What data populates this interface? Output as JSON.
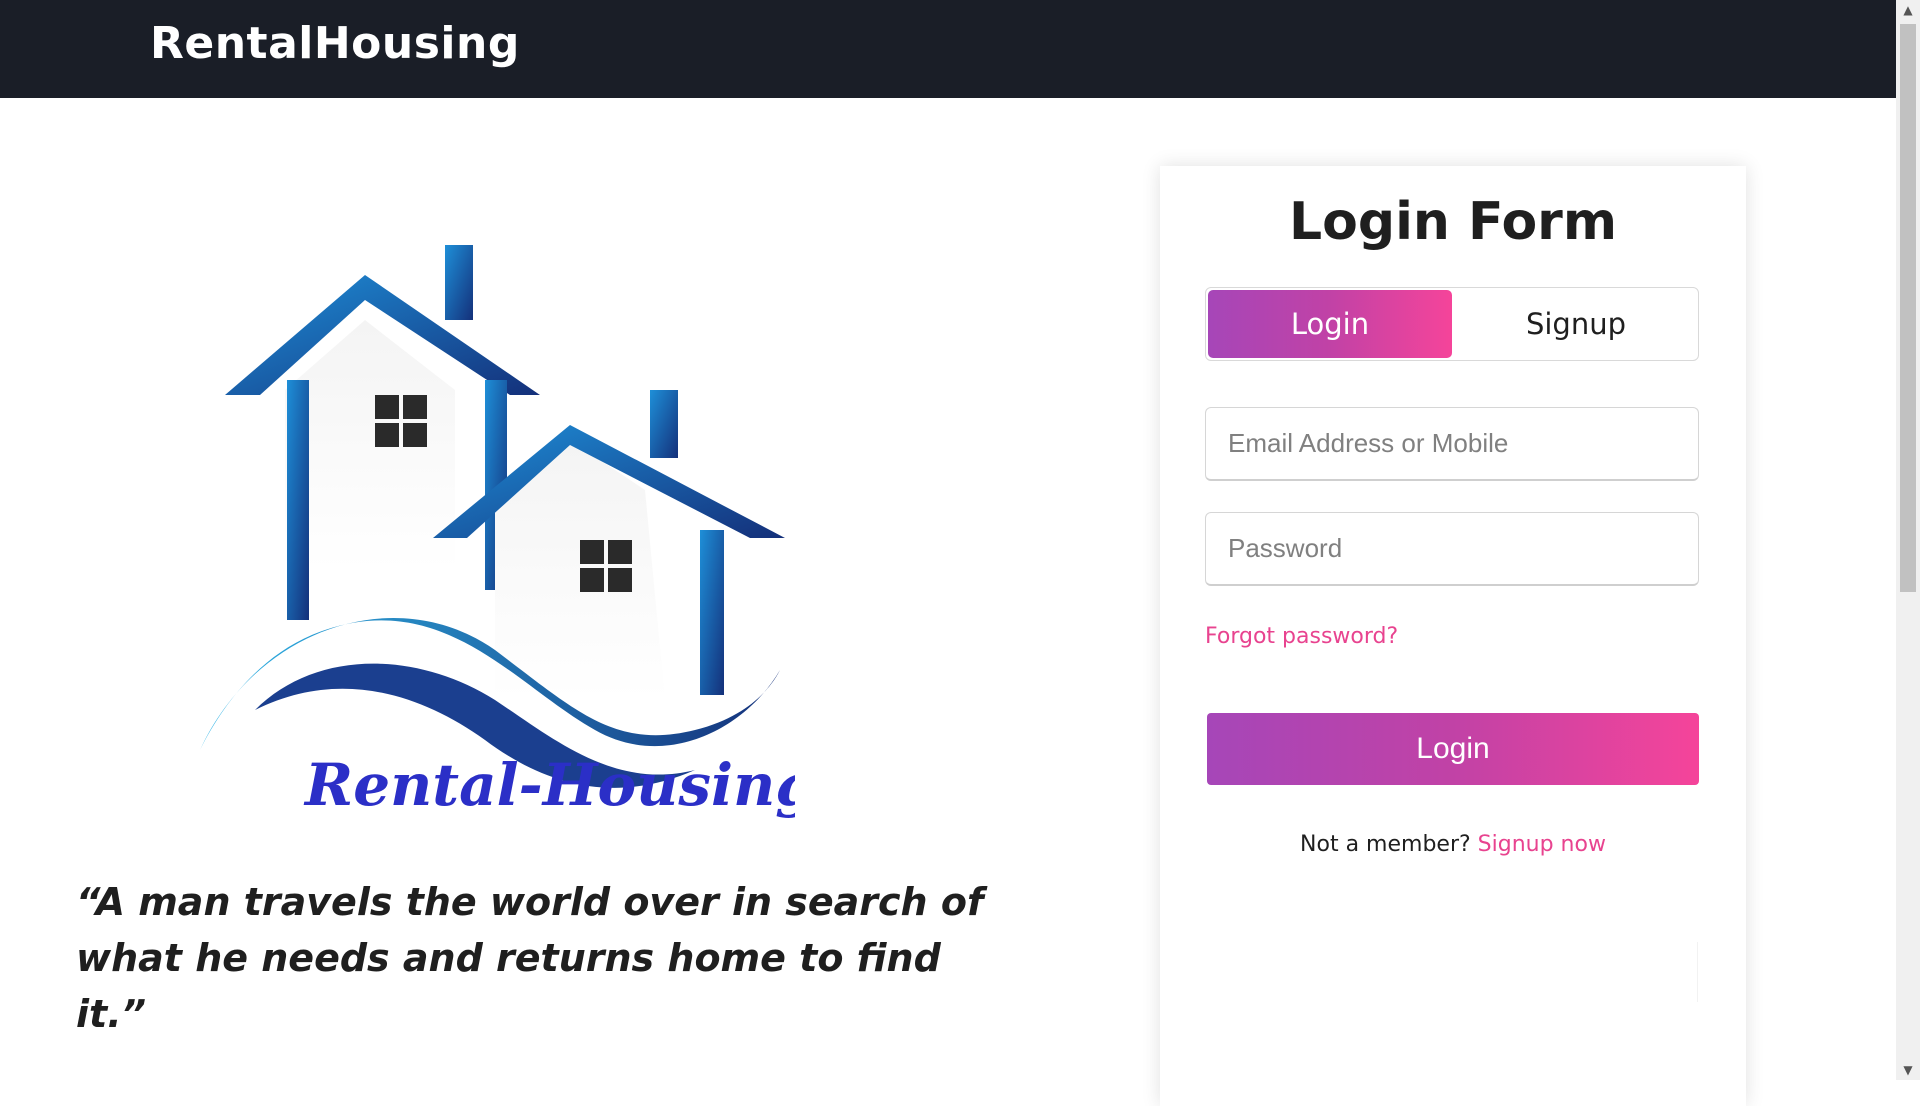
{
  "navbar": {
    "brand": "RentalHousing"
  },
  "logo": {
    "caption": "Rental-Housing"
  },
  "quote": {
    "text": "“A man travels the world over in search of what he needs and returns home to find it.”"
  },
  "login_form": {
    "title": "Login Form",
    "tabs": [
      {
        "label": "Login",
        "active": true
      },
      {
        "label": "Signup",
        "active": false
      }
    ],
    "email": {
      "placeholder": "Email Address or Mobile",
      "value": ""
    },
    "password": {
      "placeholder": "Password",
      "value": ""
    },
    "forgot_label": "Forgot password?",
    "submit_label": "Login",
    "signup_prompt": "Not a member?",
    "signup_link": "Signup now"
  },
  "colors": {
    "navbar_bg": "#1a1e27",
    "gradient_start": "#a646b8",
    "gradient_end": "#f5449a",
    "link": "#e8438f",
    "logo_blue": "#1a4fa0",
    "logo_text": "#2b2fc7"
  }
}
